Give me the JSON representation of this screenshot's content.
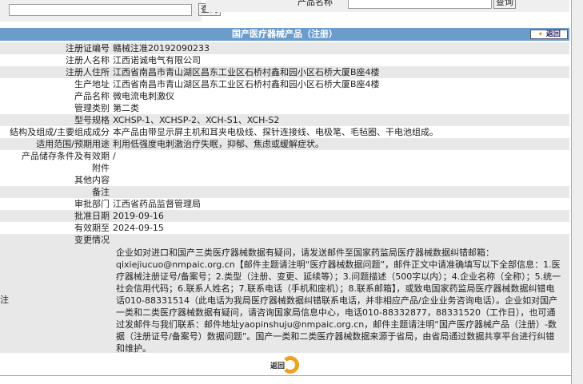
{
  "search_left": {
    "value": "",
    "button": "查询"
  },
  "search_right": {
    "label": "产品名称",
    "value": "",
    "button": "查询"
  },
  "header": {
    "title": "国产医疗器械产品（注册）",
    "back": "返回"
  },
  "fields": [
    {
      "label": "注册证编号",
      "value": "赣械注准20192090233"
    },
    {
      "label": "注册人名称",
      "value": "江西诺诚电气有限公司"
    },
    {
      "label": "注册人住所",
      "value": "江西省南昌市青山湖区昌东工业区石桥村鑫和园小区石桥大厦B座4楼"
    },
    {
      "label": "生产地址",
      "value": "江西省南昌市青山湖区昌东工业区石桥村鑫和园小区石桥大厦B座4楼"
    },
    {
      "label": "产品名称",
      "value": "微电流电刺激仪"
    },
    {
      "label": "管理类别",
      "value": "第二类"
    },
    {
      "label": "型号规格",
      "value": "XCHSP-1、XCHSP-2、XCH-S1、XCH-S2"
    },
    {
      "label": "结构及组成/主要组成成分",
      "value": "本产品由带显示屏主机和耳夹电极线、探针连接线、电极笔、毛毡圈、干电池组成。"
    },
    {
      "label": "适用范围/预期用途",
      "value": "利用低强度电刺激治疗失眠，抑郁、焦虑或缓解症状。"
    },
    {
      "label": "产品储存条件及有效期",
      "value": "/"
    },
    {
      "label": "附件",
      "value": ""
    },
    {
      "label": "其他内容",
      "value": ""
    },
    {
      "label": "备注",
      "value": ""
    },
    {
      "label": "审批部门",
      "value": "江西省药品监督管理局"
    },
    {
      "label": "批准日期",
      "value": "2019-09-16"
    },
    {
      "label": "有效期至",
      "value": "2024-09-15"
    },
    {
      "label": "变更情况",
      "value": ""
    }
  ],
  "note": {
    "label": "注",
    "text": "企业如对进口和国产三类医疗器械数据有疑问，请发送邮件至国家药监局医疗器械数据纠错邮箱：qixiejiucuo@nmpaic.org.cn【邮件主题请注明“医疗器械数据问题”，邮件正文中请准确填写以下全部信息：1.医疗器械注册证号/备案号；2.类型（注册、变更、延续等）；3.问题描述（500字以内）；4.企业名称（全称）；5.统一社会信用代码；6.联系人姓名；7.联系电话（手机和座机）；8.联系邮箱】，或致电国家药监局医疗器械数据纠错电话010-88331514（此电话为我局医疗器械数据纠错联系电话，并非相应产品/企业业务咨询电话）。企业如对国产一类和二类医疗器械数据有疑问，请咨询国家局信息中心，电话010-88332877，88331520（工作日），也可通过发邮件与我们联系：邮件地址yaopinshuju@nmpaic.org.cn，邮件主题请注明“国产医疗器械产品（注册）-数据（注册证号/备案号）数据问题”。国产一类和二类医疗器械数据来源于省局，由省局通过数据共享平台进行纠错和维护。"
  },
  "footer": {
    "back": "返回"
  },
  "colors": {
    "header": "#6a9ccc",
    "row_shade": "#e8e8e8",
    "return_accent": "#f0a020"
  }
}
